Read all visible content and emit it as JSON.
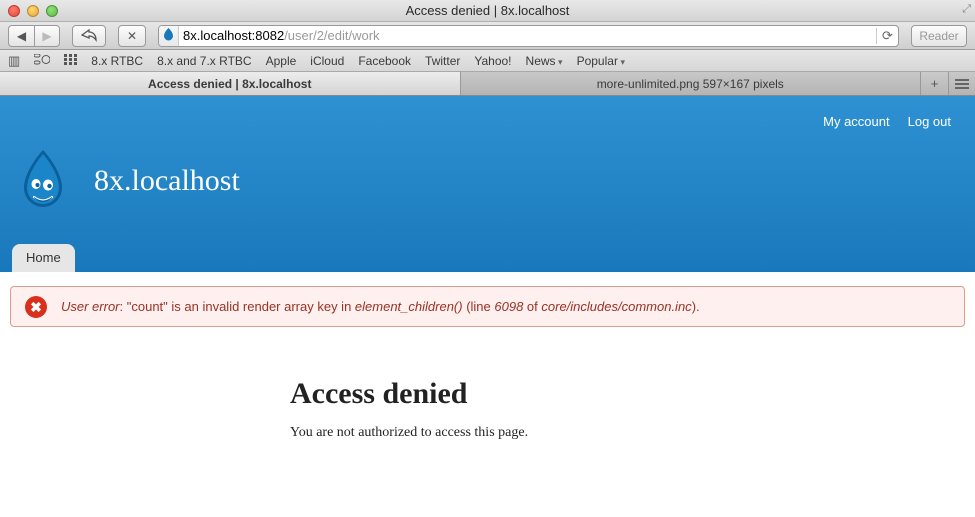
{
  "window": {
    "title": "Access denied | 8x.localhost"
  },
  "address": {
    "host": "8x.localhost:8082",
    "path": "/user/2/edit/work",
    "reader_label": "Reader"
  },
  "bookmarks": {
    "items": [
      {
        "label": "8.x RTBC",
        "folder": false
      },
      {
        "label": "8.x and 7.x RTBC",
        "folder": false
      },
      {
        "label": "Apple",
        "folder": false
      },
      {
        "label": "iCloud",
        "folder": false
      },
      {
        "label": "Facebook",
        "folder": false
      },
      {
        "label": "Twitter",
        "folder": false
      },
      {
        "label": "Yahoo!",
        "folder": false
      },
      {
        "label": "News",
        "folder": true
      },
      {
        "label": "Popular",
        "folder": true
      }
    ]
  },
  "tabs": [
    {
      "label": "Access denied | 8x.localhost",
      "active": true
    },
    {
      "label": "more-unlimited.png 597×167 pixels",
      "active": false
    }
  ],
  "header": {
    "site_name": "8x.localhost",
    "user_links": {
      "account": "My account",
      "logout": "Log out"
    },
    "nav": {
      "home": "Home"
    }
  },
  "message": {
    "prefix": "User error",
    "text_a": ": \"count\" is an invalid render array key in ",
    "fn": "element_children()",
    "text_b": " (line ",
    "line": "6098",
    "text_c": " of ",
    "file": "core/includes/common.inc",
    "text_d": ")."
  },
  "main": {
    "title": "Access denied",
    "body": "You are not authorized to access this page."
  }
}
